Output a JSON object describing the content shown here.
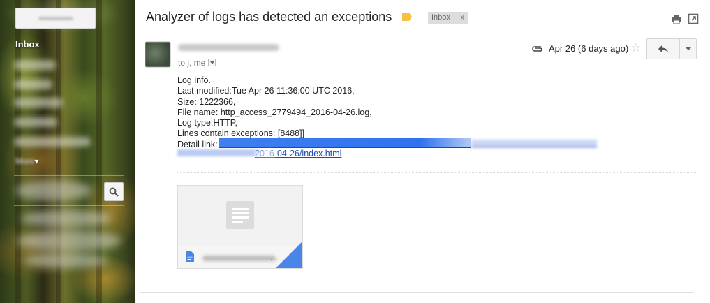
{
  "sidebar": {
    "compose_label": "",
    "active_item": "Inbox",
    "more_label": "▾",
    "colors": {
      "panel_text": "#ffffff",
      "compose_bg": "#f3f3f3"
    }
  },
  "email": {
    "subject": "Analyzer of logs has detected an exceptions",
    "label_chip": "Inbox",
    "label_chip_close": "x",
    "recipients": "to j, me",
    "date": "Apr 26 (6 days ago)",
    "body_lines": [
      "Log info.",
      "Last modified:Tue Apr 26 11:36:00 UTC 2016,",
      "Size: 1222366,",
      "File name: http_access_2779494_2016-04-26.log,",
      "Log type:HTTP,",
      "Lines contain exceptions: [8488]]"
    ],
    "detail_link_label": "Detail link:",
    "detail_link_tail": "2016-04-26/index.html",
    "attachment": {
      "ellipsis": "..."
    }
  },
  "icons": {
    "label": "label-tag-icon",
    "print": "print-icon",
    "popout": "new-window-icon",
    "attachment": "paperclip-icon",
    "star": "star-icon",
    "reply": "reply-icon",
    "search": "search-icon",
    "document": "document-icon"
  },
  "colors": {
    "label_tag": "#f6c142",
    "link": "#1a4ab6",
    "attachment_corner": "#4a86e8"
  }
}
